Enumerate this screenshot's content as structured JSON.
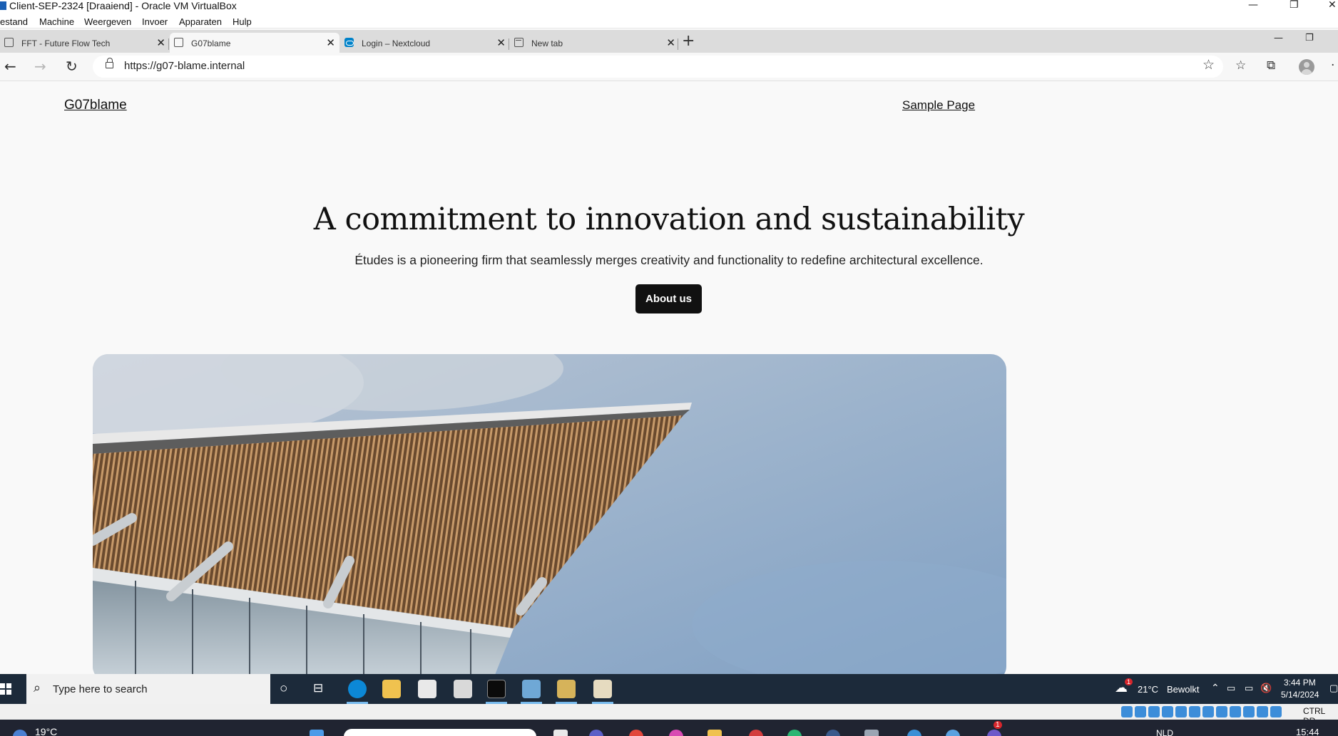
{
  "vbox": {
    "title": "Client-SEP-2324 [Draaiend] - Oracle VM VirtualBox",
    "menu": [
      "estand",
      "Machine",
      "Weergeven",
      "Invoer",
      "Apparaten",
      "Hulp"
    ],
    "status_hostkey": "CTRL DR"
  },
  "browser": {
    "tabs": [
      {
        "label": "FFT - Future Flow Tech",
        "active": false,
        "icon": "page-icon"
      },
      {
        "label": "G07blame",
        "active": true,
        "icon": "page-icon"
      },
      {
        "label": "Login – Nextcloud",
        "active": false,
        "icon": "nextcloud-icon"
      },
      {
        "label": "New tab",
        "active": false,
        "icon": "new-tab-icon"
      }
    ],
    "url": "https://g07-blame.internal"
  },
  "site": {
    "title": "G07blame",
    "nav": [
      "Sample Page"
    ],
    "hero_heading": "A commitment to innovation and sustainability",
    "hero_subtext": "Études is a pioneering firm that seamlessly merges creativity and functionality to redefine architectural excellence.",
    "cta_label": "About us"
  },
  "taskbar": {
    "search_placeholder": "Type here to search",
    "weather_temp": "21°C",
    "weather_text": "Bewolkt",
    "weather_badge": "1",
    "time": "3:44 PM",
    "date": "5/14/2024"
  },
  "host": {
    "temp": "19°C",
    "lang": "NLD",
    "time": "15:44",
    "badge": "1"
  },
  "colors": {
    "page_bg": "#f9f9f9",
    "button_bg": "#111111",
    "taskbar_bg": "#1c2a3a",
    "edge_blue": "#0c88d6",
    "accent_blue": "#76b9ed"
  }
}
